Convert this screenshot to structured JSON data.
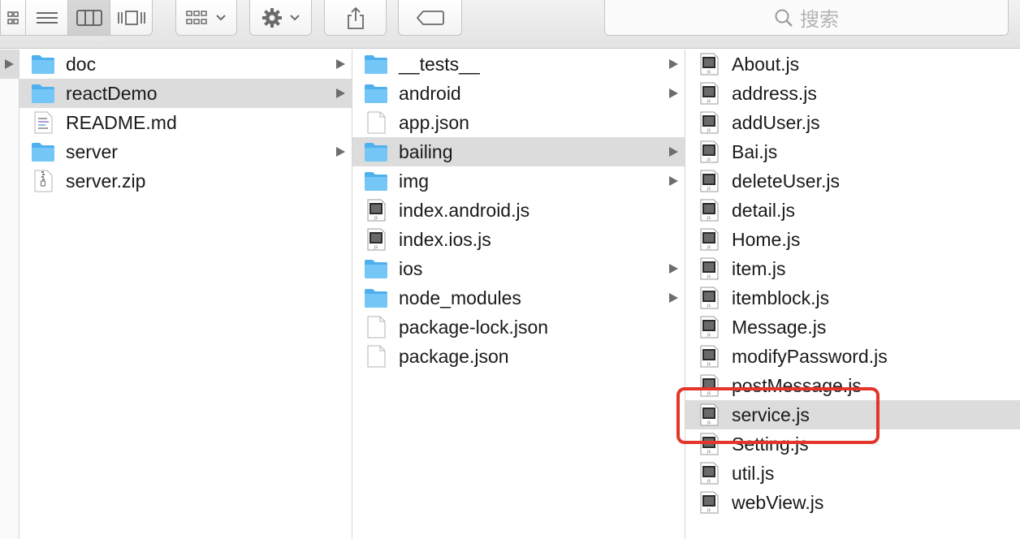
{
  "toolbar": {
    "search_label": "搜索",
    "buttons": [
      "icon-view-icon",
      "list-view-icon",
      "column-view-icon",
      "cover-flow-icon",
      "group-icon",
      "action-gear-icon",
      "share-icon",
      "tag-icon"
    ]
  },
  "columns": [
    {
      "items": [
        {
          "name": "doc",
          "type": "folder",
          "has_children": true,
          "selected": false
        },
        {
          "name": "reactDemo",
          "type": "folder",
          "has_children": true,
          "selected": true
        },
        {
          "name": "README.md",
          "type": "md",
          "has_children": false,
          "selected": false
        },
        {
          "name": "server",
          "type": "folder",
          "has_children": true,
          "selected": false
        },
        {
          "name": "server.zip",
          "type": "zip",
          "has_children": false,
          "selected": false
        }
      ]
    },
    {
      "items": [
        {
          "name": "__tests__",
          "type": "folder",
          "has_children": true,
          "selected": false
        },
        {
          "name": "android",
          "type": "folder",
          "has_children": true,
          "selected": false
        },
        {
          "name": "app.json",
          "type": "doc",
          "has_children": false,
          "selected": false
        },
        {
          "name": "bailing",
          "type": "folder",
          "has_children": true,
          "selected": true
        },
        {
          "name": "img",
          "type": "folder",
          "has_children": true,
          "selected": false
        },
        {
          "name": "index.android.js",
          "type": "js",
          "has_children": false,
          "selected": false
        },
        {
          "name": "index.ios.js",
          "type": "js",
          "has_children": false,
          "selected": false
        },
        {
          "name": "ios",
          "type": "folder",
          "has_children": true,
          "selected": false
        },
        {
          "name": "node_modules",
          "type": "folder",
          "has_children": true,
          "selected": false
        },
        {
          "name": "package-lock.json",
          "type": "doc",
          "has_children": false,
          "selected": false
        },
        {
          "name": "package.json",
          "type": "doc",
          "has_children": false,
          "selected": false
        }
      ]
    },
    {
      "items": [
        {
          "name": "About.js",
          "type": "js",
          "has_children": false,
          "selected": false
        },
        {
          "name": "address.js",
          "type": "js",
          "has_children": false,
          "selected": false
        },
        {
          "name": "addUser.js",
          "type": "js",
          "has_children": false,
          "selected": false
        },
        {
          "name": "Bai.js",
          "type": "js",
          "has_children": false,
          "selected": false
        },
        {
          "name": "deleteUser.js",
          "type": "js",
          "has_children": false,
          "selected": false
        },
        {
          "name": "detail.js",
          "type": "js",
          "has_children": false,
          "selected": false
        },
        {
          "name": "Home.js",
          "type": "js",
          "has_children": false,
          "selected": false
        },
        {
          "name": "item.js",
          "type": "js",
          "has_children": false,
          "selected": false
        },
        {
          "name": "itemblock.js",
          "type": "js",
          "has_children": false,
          "selected": false
        },
        {
          "name": "Message.js",
          "type": "js",
          "has_children": false,
          "selected": false
        },
        {
          "name": "modifyPassword.js",
          "type": "js",
          "has_children": false,
          "selected": false
        },
        {
          "name": "postMessage.js",
          "type": "js",
          "has_children": false,
          "selected": false
        },
        {
          "name": "service.js",
          "type": "js",
          "has_children": false,
          "selected": true
        },
        {
          "name": "Setting.js",
          "type": "js",
          "has_children": false,
          "selected": false
        },
        {
          "name": "util.js",
          "type": "js",
          "has_children": false,
          "selected": false
        },
        {
          "name": "webView.js",
          "type": "js",
          "has_children": false,
          "selected": false
        }
      ]
    }
  ],
  "colors": {
    "selection": "#dcdcdc",
    "folder": "#6ec3f5",
    "annotation": "#e3352a"
  }
}
